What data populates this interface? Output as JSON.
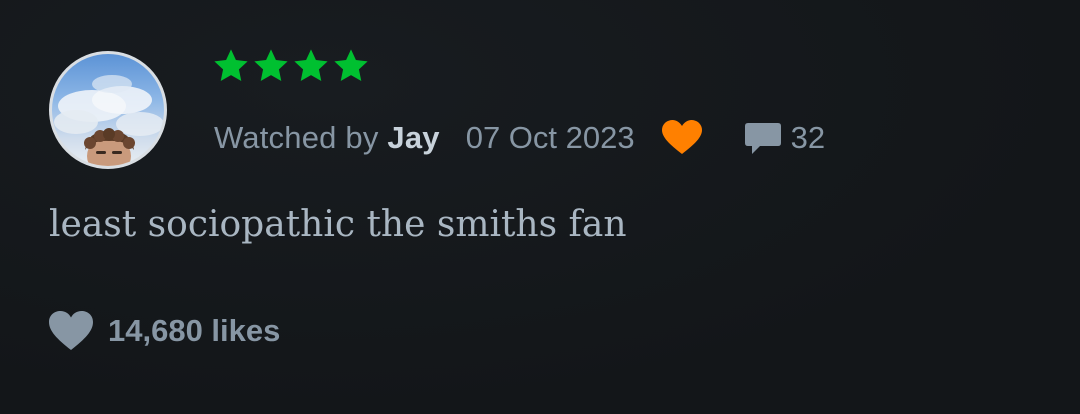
{
  "review": {
    "rating": 4,
    "rating_max": 5,
    "watched_prefix": "Watched by",
    "reviewer_name": "Jay",
    "date": "07 Oct 2023",
    "liked": true,
    "comment_count": "32",
    "body": "least sociopathic the smiths fan",
    "likes_label": "14,680 likes"
  },
  "icons": {
    "star": "star-icon",
    "like": "heart-icon",
    "comment": "comment-bubble-icon",
    "likes": "heart-icon"
  },
  "colors": {
    "background": "#14181c",
    "star_green": "#00c030",
    "liked_orange": "#ff8000",
    "muted_text": "#8796a4",
    "name_text": "#c8d2db",
    "body_text": "#a9b6c2"
  }
}
